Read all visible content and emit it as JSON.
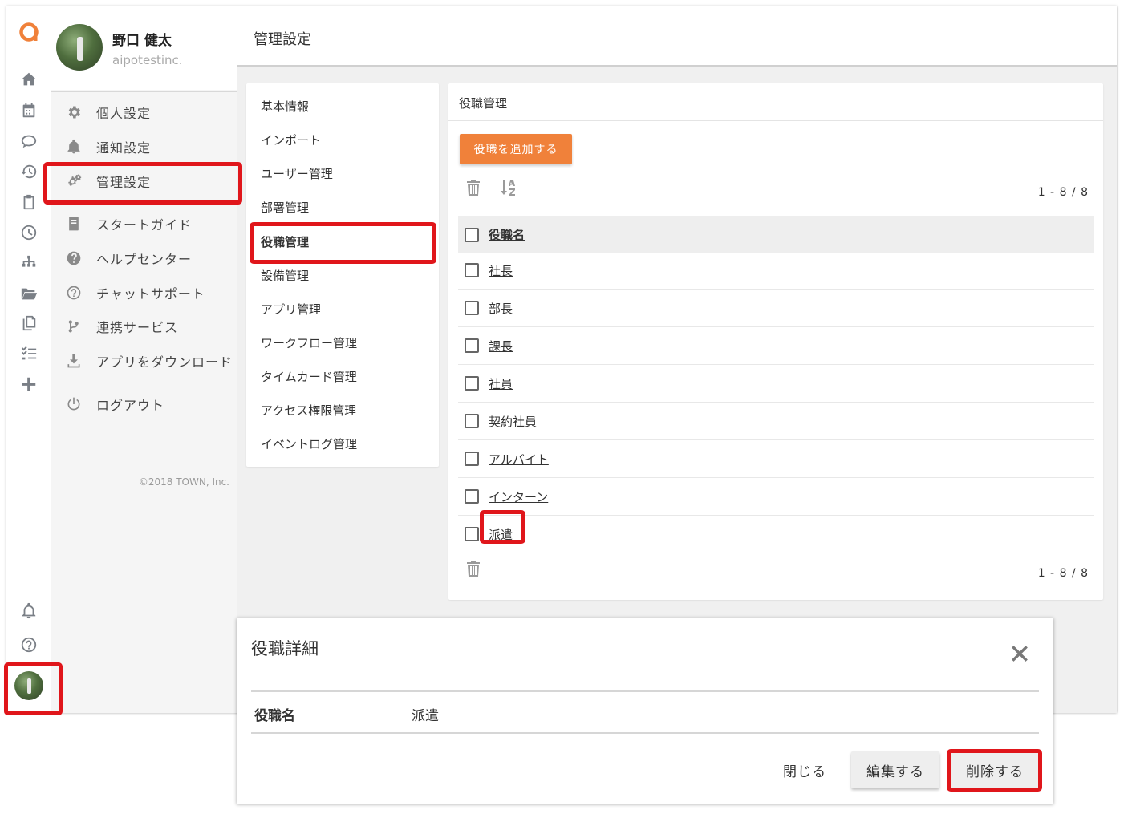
{
  "user": {
    "name": "野口 健太",
    "org": "aipotestinc."
  },
  "header": {
    "title": "管理設定"
  },
  "menu": {
    "items": [
      {
        "label": "個人設定",
        "icon": "gear-icon"
      },
      {
        "label": "通知設定",
        "icon": "bell-icon"
      },
      {
        "label": "管理設定",
        "icon": "gears-icon"
      },
      {
        "label": "スタートガイド",
        "icon": "book-icon"
      },
      {
        "label": "ヘルプセンター",
        "icon": "help-circle-icon"
      },
      {
        "label": "チャットサポート",
        "icon": "question-outline-icon"
      },
      {
        "label": "連携サービス",
        "icon": "branch-icon"
      },
      {
        "label": "アプリをダウンロード",
        "icon": "download-icon"
      },
      {
        "label": "ログアウト",
        "icon": "power-icon"
      }
    ],
    "copyright": "©2018 TOWN, Inc."
  },
  "subnav": {
    "items": [
      "基本情報",
      "インポート",
      "ユーザー管理",
      "部署管理",
      "役職管理",
      "設備管理",
      "アプリ管理",
      "ワークフロー管理",
      "タイムカード管理",
      "アクセス権限管理",
      "イベントログ管理"
    ],
    "active": "役職管理"
  },
  "card": {
    "title": "役職管理",
    "add_button": "役職を追加する",
    "count_top": "1 - 8 / 8",
    "count_bottom": "1 - 8 / 8",
    "column_header": "役職名",
    "rows": [
      "社長",
      "部長",
      "課長",
      "社員",
      "契約社員",
      "アルバイト",
      "インターン",
      "派遣"
    ]
  },
  "dialog": {
    "title": "役職詳細",
    "field_label": "役職名",
    "field_value": "派遣",
    "close_button": "閉じる",
    "edit_button": "編集する",
    "delete_button": "削除する"
  },
  "colors": {
    "accent": "#f0813a",
    "highlight": "#e0161b"
  }
}
